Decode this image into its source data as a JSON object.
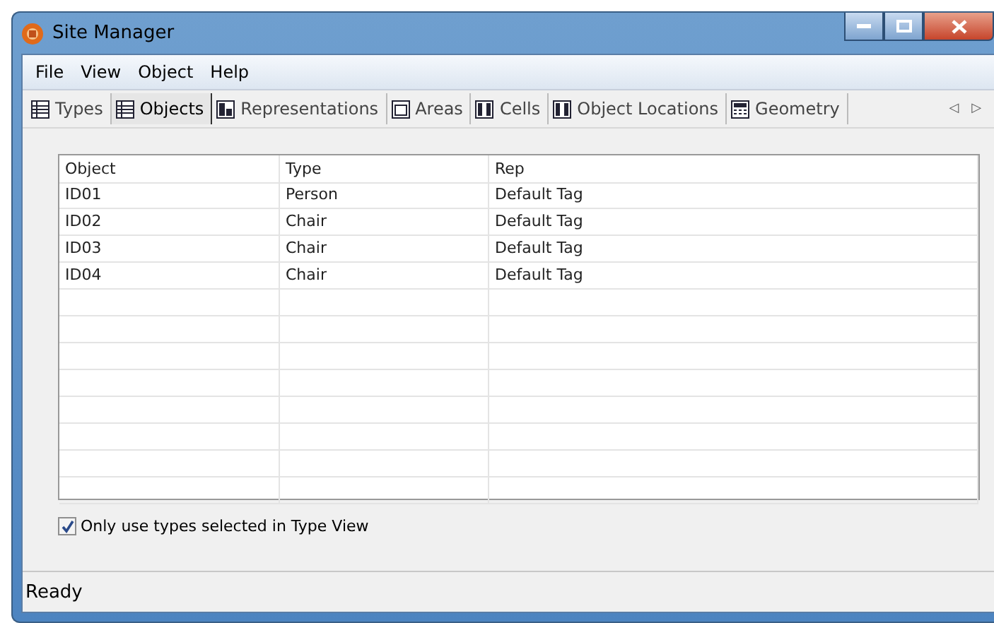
{
  "window": {
    "title": "Site Manager"
  },
  "menu": [
    "File",
    "View",
    "Object",
    "Help"
  ],
  "tabs": [
    {
      "label": "Types",
      "selected": false,
      "kind": "table"
    },
    {
      "label": "Objects",
      "selected": true,
      "kind": "table"
    },
    {
      "label": "Representations",
      "selected": false,
      "kind": "tag"
    },
    {
      "label": "Areas",
      "selected": false,
      "kind": "frame"
    },
    {
      "label": "Cells",
      "selected": false,
      "kind": "cells"
    },
    {
      "label": "Object Locations",
      "selected": false,
      "kind": "cells"
    },
    {
      "label": "Geometry",
      "selected": false,
      "kind": "calc"
    }
  ],
  "tab_scroll": [
    "◁",
    "▷"
  ],
  "table": {
    "columns": [
      "Object",
      "Type",
      "Rep"
    ],
    "rows": [
      [
        "ID01",
        "Person",
        "Default Tag"
      ],
      [
        "ID02",
        "Chair",
        "Default Tag"
      ],
      [
        "ID03",
        "Chair",
        "Default Tag"
      ],
      [
        "ID04",
        "Chair",
        "Default Tag"
      ]
    ]
  },
  "option": {
    "label": "Only use types selected in Type View",
    "checked": true
  },
  "status_bar": "Ready"
}
